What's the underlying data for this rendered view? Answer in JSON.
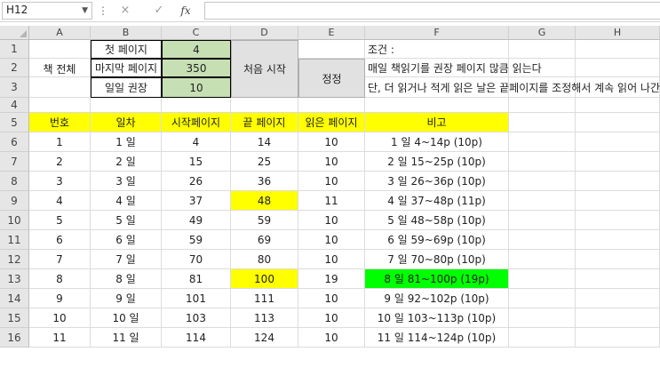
{
  "formula_bar": {
    "name_box": "H12",
    "cancel_icon": "×",
    "enter_icon": "✓",
    "fx_label": "fx",
    "formula": ""
  },
  "columns": [
    "A",
    "B",
    "C",
    "D",
    "E",
    "F",
    "G",
    "H"
  ],
  "rows": [
    "1",
    "2",
    "3",
    "4",
    "5",
    "6",
    "7",
    "8",
    "9",
    "10",
    "11",
    "12",
    "13",
    "14",
    "15",
    "16"
  ],
  "setup": {
    "book_label": "책 전체",
    "first_page_label": "첫 페이지",
    "first_page_value": "4",
    "last_page_label": "마지막 페이지",
    "last_page_value": "350",
    "daily_label": "일일 권장",
    "daily_value": "10",
    "start_button": "처음 시작",
    "adjust_button": "정정",
    "cond_title": "조건 :",
    "cond_1": "매일 책읽기를 권장 페이지 많큼 읽는다",
    "cond_2": "단, 더 읽거나 적게 읽은 날은 끝페이지를 조정해서 계속 읽어 나간다"
  },
  "table": {
    "headers": [
      "번호",
      "일차",
      "시작페이지",
      "끝 페이지",
      "읽은 페이지",
      "비고"
    ],
    "rows": [
      [
        "1",
        "1 일",
        "4",
        "14",
        "10",
        "1 일 4~14p (10p)"
      ],
      [
        "2",
        "2 일",
        "15",
        "25",
        "10",
        "2 일 15~25p (10p)"
      ],
      [
        "3",
        "3 일",
        "26",
        "36",
        "10",
        "3 일 26~36p (10p)"
      ],
      [
        "4",
        "4 일",
        "37",
        "48",
        "11",
        "4 일 37~48p (11p)"
      ],
      [
        "5",
        "5 일",
        "49",
        "59",
        "10",
        "5 일 48~58p (10p)"
      ],
      [
        "6",
        "6 일",
        "59",
        "69",
        "10",
        "6 일 59~69p (10p)"
      ],
      [
        "7",
        "7 일",
        "70",
        "80",
        "10",
        "7 일 70~80p (10p)"
      ],
      [
        "8",
        "8 일",
        "81",
        "100",
        "19",
        "8 일 81~100p (19p)"
      ],
      [
        "9",
        "9 일",
        "101",
        "111",
        "10",
        "9 일 92~102p (10p)"
      ],
      [
        "10",
        "10 일",
        "103",
        "113",
        "10",
        "10 일 103~113p (10p)"
      ],
      [
        "11",
        "11 일",
        "114",
        "124",
        "10",
        "11 일 114~124p (10p)"
      ]
    ]
  },
  "colors": {
    "header_yellow": "#ffff00",
    "input_green": "#c6e0b4",
    "highlight_green": "#00ff00"
  }
}
